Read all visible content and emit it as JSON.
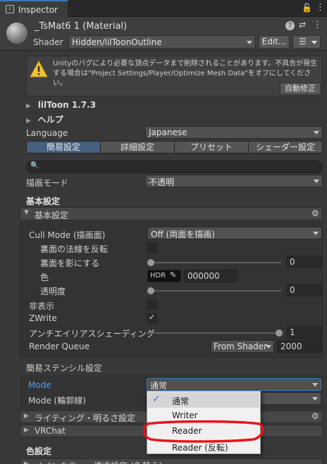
{
  "tab": {
    "label": "Inspector",
    "lock_icon": "lock-icon",
    "menu_icon": "kebab-menu-icon"
  },
  "header": {
    "title": "_TsMat6 1 (Material)",
    "shader_label": "Shader",
    "shader_value": "Hidden/lilToonOutline",
    "edit_button": "Edit...",
    "list_icon": "list-icon"
  },
  "warning": {
    "text": "Unityのバグにより必要な頂点データまで削除されることがあります。不具合が発生する場合は\"Project Settings/Player/Optimize Mesh Data\"をオフにしてください。",
    "fix_button": "自動修正"
  },
  "foldouts": {
    "liltoon": "lilToon 1.7.3",
    "help": "ヘルプ"
  },
  "language": {
    "label": "Language",
    "value": "Japanese"
  },
  "mode_tabs": [
    "簡易設定",
    "詳細設定",
    "プリセット",
    "シェーダー設定"
  ],
  "search": {
    "placeholder": ""
  },
  "render_mode": {
    "label": "描画モード",
    "value": "不透明"
  },
  "basic": {
    "heading": "基本設定",
    "foldout_label": "基本設定",
    "cull_label": "Cull Mode (描画面)",
    "cull_value": "Off (両面を描画)",
    "flip_normal_label": "裏面の法線を反転",
    "shadow_back_label": "裏面を影にする",
    "shadow_back_value": "0",
    "color_label": "色",
    "hdr_label": "HDR",
    "color_hex": "000000",
    "transparency_label": "透明度",
    "transparency_value": "0",
    "hide_label": "非表示",
    "zwrite_label": "ZWrite",
    "zwrite_checked": true,
    "aa_label": "アンチエイリアスシェーディング",
    "aa_value": "1",
    "render_queue_label": "Render Queue",
    "render_queue_source": "From Shader",
    "render_queue_value": "2000"
  },
  "stencil": {
    "heading": "簡易ステンシル設定",
    "mode_label": "Mode",
    "mode_value": "通常",
    "outline_mode_label": "Mode (輪郭線)"
  },
  "sections": {
    "lighting": "ライティング・明るさ設定",
    "vrchat": "VRChat",
    "color_heading": "色設定",
    "main_color": "メインカラー・透過設定 (色替え)"
  },
  "popup": {
    "items": [
      "通常",
      "Writer",
      "Reader",
      "Reader (反転)"
    ],
    "selected_index": 0
  }
}
